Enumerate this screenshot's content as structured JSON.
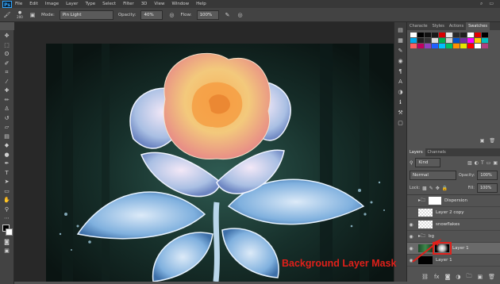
{
  "app": {
    "logo": "Ps"
  },
  "menu": [
    "File",
    "Edit",
    "Image",
    "Layer",
    "Type",
    "Select",
    "Filter",
    "3D",
    "View",
    "Window",
    "Help"
  ],
  "menu_right_icons": [
    "search-icon",
    "workspace-icon"
  ],
  "options": {
    "brush_size": "200",
    "mode_label": "Mode:",
    "mode_value": "Pin Light",
    "opacity_label": "Opacity:",
    "opacity_value": "40%",
    "flow_label": "Flow:",
    "flow_value": "100%"
  },
  "tools": [
    "move",
    "marquee",
    "lasso",
    "quick-select",
    "crop",
    "eyedropper",
    "healing",
    "brush",
    "stamp",
    "history-brush",
    "eraser",
    "gradient",
    "blur",
    "dodge",
    "pen",
    "type",
    "path-select",
    "shape",
    "hand",
    "zoom",
    "more",
    "colors",
    "quick-mask",
    "screen-mode"
  ],
  "top_panel": {
    "tabs": [
      "Characte",
      "Styles",
      "Actions",
      "Swatches"
    ],
    "active_tab": "Swatches"
  },
  "swatches": [
    "#ffffff",
    "#000000",
    "#111111",
    "#1a1a1a",
    "#d60000",
    "#e8e8e8",
    "#2a2a2a",
    "#1f1f1f",
    "#ffffff",
    "#e00000",
    "#000000",
    "#00a8e8",
    "#222222",
    "#333333",
    "#e0e0e0",
    "#00b050",
    "#d0d0d0",
    "#0050c8",
    "#7030a0",
    "#ff00ff",
    "#ffcc00",
    "#00c0c0",
    "#ff6060",
    "#c00060",
    "#9040c0",
    "#2060ff",
    "#00c0ff",
    "#00c060",
    "#ff9000",
    "#e6e600",
    "#ff0000",
    "#ffffff",
    "#b04080"
  ],
  "layers_panel": {
    "tabs": [
      "Layers",
      "Channels"
    ],
    "active_tab": "Layers",
    "filter": "Kind",
    "blend": "Normal",
    "opacity_label": "Opacity:",
    "opacity_value": "100%",
    "lock_label": "Lock:",
    "fill_label": "Fill:",
    "fill_value": "100%",
    "layers": [
      {
        "name": "Dispersion",
        "visible": false,
        "type": "group"
      },
      {
        "name": "Layer 2 copy",
        "visible": false,
        "type": "layer"
      },
      {
        "name": "snowflakes",
        "visible": true,
        "type": "layer"
      },
      {
        "name": "bg",
        "visible": true,
        "type": "group"
      },
      {
        "name": "Layer 1",
        "visible": true,
        "type": "layer-with-mask",
        "selected": true
      },
      {
        "name": "Layer 1",
        "visible": true,
        "type": "layer"
      }
    ]
  },
  "annotation": {
    "text": "Background Layer Mask",
    "color": "#e0201a"
  }
}
